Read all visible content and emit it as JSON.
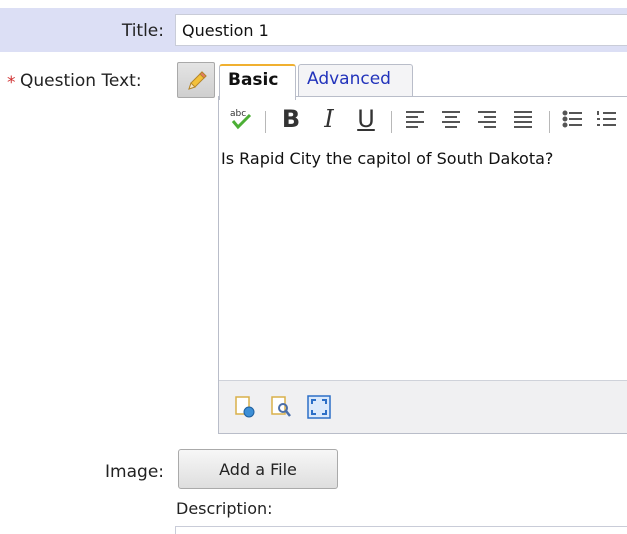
{
  "form": {
    "title_label": "Title:",
    "title_value": "Question 1",
    "required_marker": "*",
    "question_text_label": "Question Text:",
    "image_label": "Image:",
    "add_file_label": "Add a File",
    "description_label": "Description:"
  },
  "editor": {
    "tabs": [
      {
        "label": "Basic",
        "selected": true
      },
      {
        "label": "Advanced",
        "selected": false
      }
    ],
    "toolbar": {
      "spellcheck_icon": "spellcheck-icon",
      "bold_label": "B",
      "italic_label": "I",
      "underline_label": "U",
      "align_icons": [
        "align-left-icon",
        "align-center-icon",
        "align-right-icon",
        "align-justify-icon"
      ],
      "list_icons": [
        "bulleted-list-icon",
        "numbered-list-icon"
      ]
    },
    "content": "Is Rapid City the capitol of South Dakota?",
    "footer_icons": [
      "design-mode-icon",
      "preview-icon",
      "fullscreen-icon"
    ]
  },
  "colors": {
    "title_row_bg": "#dcdff5",
    "required_star": "#d03030",
    "advanced_tab_text": "#2233bb",
    "active_tab_accent": "#f0b030"
  }
}
